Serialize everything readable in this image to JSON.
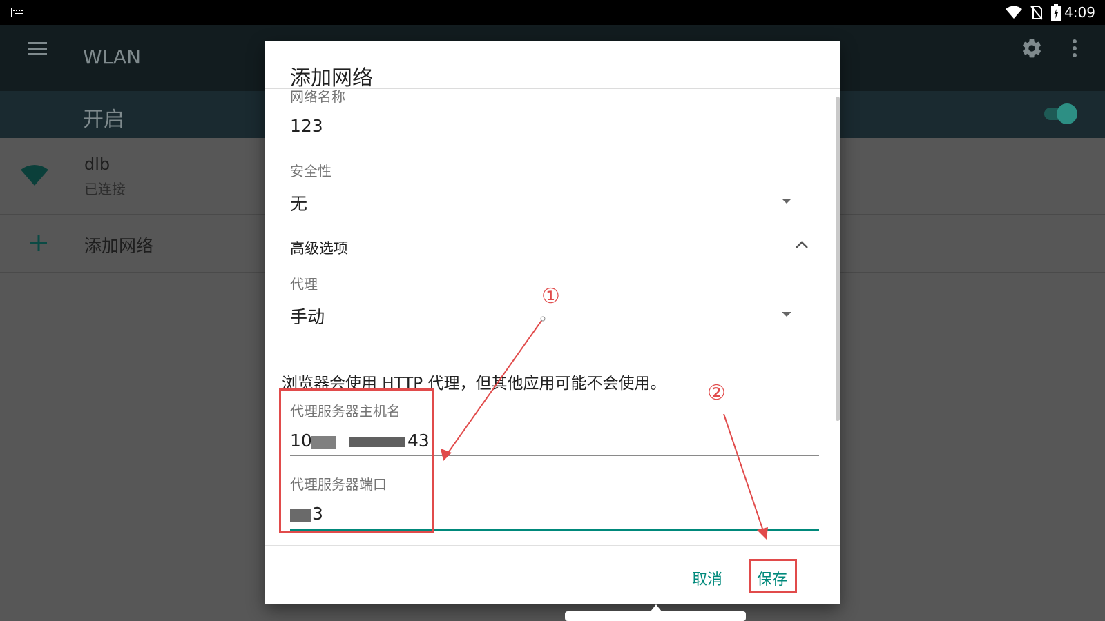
{
  "status_bar": {
    "time": "4:09",
    "icons": [
      "keyboard-icon",
      "wifi-icon",
      "no-sim-icon",
      "battery-charging-icon"
    ]
  },
  "app_bar": {
    "title": "WLAN",
    "menu_icon": "hamburger-menu-icon",
    "settings_icon": "gear-icon",
    "overflow_icon": "more-vert-icon"
  },
  "wifi_switch": {
    "label": "开启",
    "state": "on"
  },
  "networks": [
    {
      "ssid": "dlb",
      "status": "已连接"
    }
  ],
  "add_network_item": {
    "label": "添加网络"
  },
  "dialog": {
    "title": "添加网络",
    "ssid_label": "网络名称",
    "ssid_value": "123",
    "security_label": "安全性",
    "security_value": "无",
    "advanced_label": "高级选项",
    "proxy_label": "代理",
    "proxy_value": "手动",
    "proxy_note": "浏览器会使用 HTTP 代理，但其他应用可能不会使用。",
    "proxy_host_label": "代理服务器主机名",
    "proxy_host_value_prefix": "10",
    "proxy_host_value_suffix": "43",
    "proxy_port_label": "代理服务器端口",
    "proxy_port_value_suffix": "3",
    "cancel_label": "取消",
    "save_label": "保存"
  },
  "annotations": {
    "marker_1": "①",
    "marker_2": "②"
  },
  "colors": {
    "accent": "#00897b",
    "annotation_red": "#e14b4b",
    "dialog_bg": "#ffffff",
    "dim_bg": "#575757"
  }
}
